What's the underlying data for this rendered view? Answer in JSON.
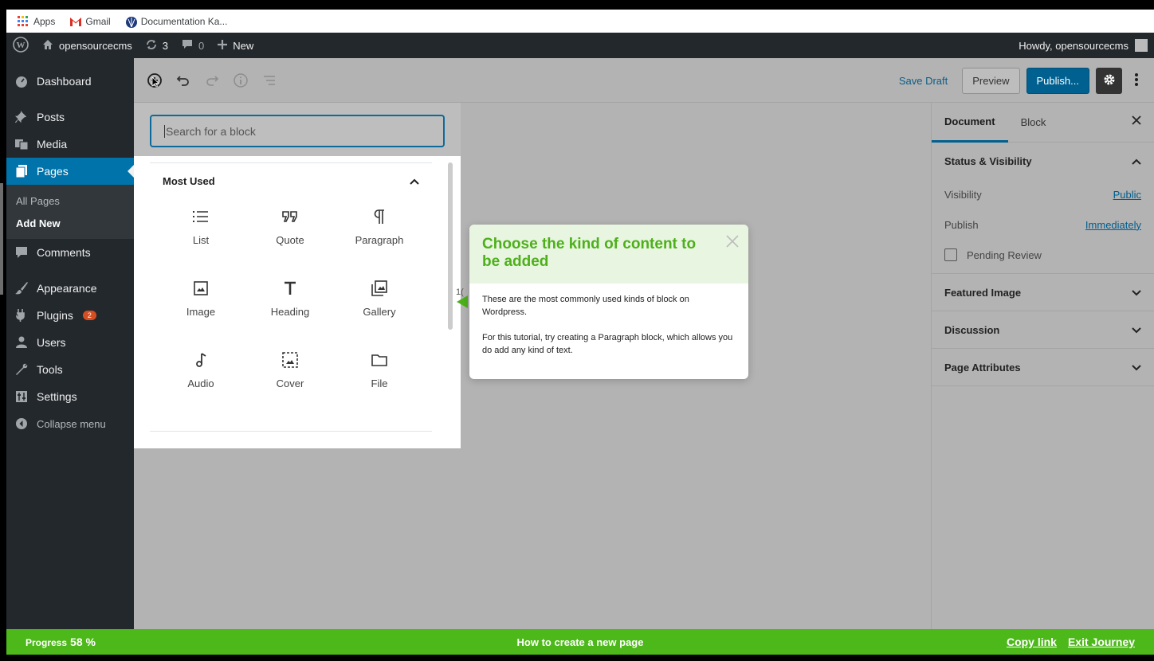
{
  "browser": {
    "bookmarks": [
      {
        "label": "Apps",
        "icon": "apps-grid-icon"
      },
      {
        "label": "Gmail",
        "icon": "gmail-icon"
      },
      {
        "label": "Documentation Ka...",
        "icon": "shell-icon"
      }
    ]
  },
  "adminbar": {
    "site_name": "opensourcecms",
    "updates_count": "3",
    "comments_count": "0",
    "new_label": "New",
    "howdy": "Howdy, opensourcecms"
  },
  "menu": {
    "dashboard": "Dashboard",
    "posts": "Posts",
    "media": "Media",
    "pages": "Pages",
    "all_pages": "All Pages",
    "add_new": "Add New",
    "comments": "Comments",
    "appearance": "Appearance",
    "plugins": "Plugins",
    "plugins_badge": "2",
    "users": "Users",
    "tools": "Tools",
    "settings": "Settings",
    "collapse": "Collapse menu"
  },
  "toolbar": {
    "save_draft": "Save Draft",
    "preview": "Preview",
    "publish": "Publish..."
  },
  "inserter": {
    "search_placeholder": "Search for a block",
    "section_title": "Most Used",
    "blocks": [
      {
        "label": "List",
        "icon": "list-icon"
      },
      {
        "label": "Quote",
        "icon": "quote-icon"
      },
      {
        "label": "Paragraph",
        "icon": "paragraph-icon"
      },
      {
        "label": "Image",
        "icon": "image-icon"
      },
      {
        "label": "Heading",
        "icon": "heading-icon"
      },
      {
        "label": "Gallery",
        "icon": "gallery-icon"
      },
      {
        "label": "Audio",
        "icon": "audio-icon"
      },
      {
        "label": "Cover",
        "icon": "cover-icon"
      },
      {
        "label": "File",
        "icon": "file-icon"
      }
    ]
  },
  "tooltip": {
    "title": "Choose the kind of content to be added",
    "body1": "These are the most commonly used kinds of block on Wordpress.",
    "body2": "For this tutorial, try creating a Paragraph block, which allows you do add any kind of text.",
    "behind_text": "1("
  },
  "sidebar": {
    "tab_document": "Document",
    "tab_block": "Block",
    "status_visibility": "Status & Visibility",
    "visibility_label": "Visibility",
    "visibility_value": "Public",
    "publish_label": "Publish",
    "publish_value": "Immediately",
    "pending_review": "Pending Review",
    "featured_image": "Featured Image",
    "discussion": "Discussion",
    "page_attributes": "Page Attributes"
  },
  "progress": {
    "label": "Progress",
    "percent": "58 %",
    "journey_title": "How to create a new page",
    "copy_link": "Copy link",
    "exit_journey": "Exit Journey"
  },
  "colors": {
    "accent_green": "#4db81a",
    "wp_blue": "#0073aa",
    "admin_dark": "#23282d"
  }
}
